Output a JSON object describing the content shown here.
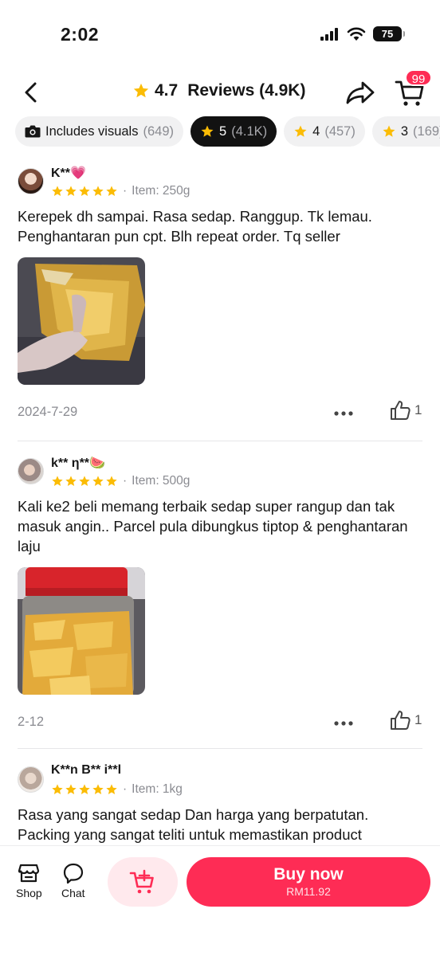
{
  "status_bar": {
    "time": "2:02",
    "battery": "75"
  },
  "header": {
    "rating": "4.7",
    "title": "Reviews (4.9K)",
    "cart_badge": "99"
  },
  "filters": [
    {
      "label": "Includes visuals",
      "count": "(649)"
    },
    {
      "label": "5",
      "count": "(4.1K)"
    },
    {
      "label": "4",
      "count": "(457)"
    },
    {
      "label": "3",
      "count": "(169)"
    }
  ],
  "reviews": [
    {
      "user": "K**💗",
      "item": "Item: 250g",
      "text": "Kerepek dh sampai. Rasa sedap. Ranggup. Tk lemau. Penghantaran pun cpt. Blh repeat order. Tq seller",
      "date": "2024-7-29",
      "likes": "1"
    },
    {
      "user": "k** η**🍉",
      "item": "Item: 500g",
      "text": "Kali ke2 beli memang terbaik sedap super rangup dan tak masuk angin.. Parcel pula dibungkus tiptop & penghantaran laju",
      "date": "2-12",
      "likes": "1"
    },
    {
      "user": "K**n B** i**l",
      "item": "Item: 1kg",
      "text": "Rasa yang sangat sedap Dan harga yang berpatutan. Packing yang sangat teliti untuk memastikan product"
    }
  ],
  "bottom_bar": {
    "shop": "Shop",
    "chat": "Chat",
    "buy_label": "Buy now",
    "buy_price": "RM11.92"
  },
  "colors": {
    "accent": "#fe2c55",
    "star": "#fbbc05",
    "muted": "#8a8b91"
  }
}
